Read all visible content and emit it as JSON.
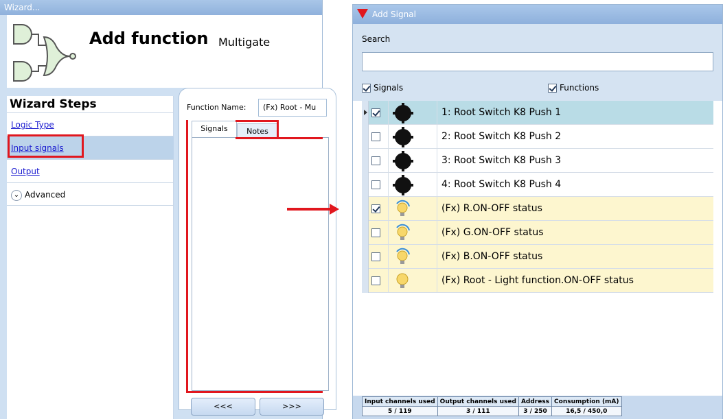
{
  "wizard": {
    "window_title": "Wizard...",
    "header_title": "Add function",
    "header_subtitle": "Multigate",
    "steps_title": "Wizard Steps",
    "steps": [
      {
        "label": "Logic Type"
      },
      {
        "label": "Input signals"
      },
      {
        "label": "Output"
      }
    ],
    "advanced_label": "Advanced",
    "function_name_label": "Function Name:",
    "function_name_value": "(Fx) Root - Mu",
    "tabs": [
      {
        "label": "Signals"
      },
      {
        "label": "Notes"
      }
    ],
    "back_button": "<<<",
    "next_button": ">>>"
  },
  "add_signal": {
    "window_title": "Add Signal",
    "search_label": "Search",
    "search_value": "",
    "filter_signals": {
      "label": "Signals",
      "checked": true
    },
    "filter_functions": {
      "label": "Functions",
      "checked": true
    },
    "rows": [
      {
        "checked": true,
        "icon": "push-button-icon",
        "label": "1: Root Switch K8 Push 1",
        "state": "selected"
      },
      {
        "checked": false,
        "icon": "push-button-icon",
        "label": "2: Root Switch K8 Push 2",
        "state": "normal"
      },
      {
        "checked": false,
        "icon": "push-button-icon",
        "label": "3: Root Switch K8 Push 3",
        "state": "normal"
      },
      {
        "checked": false,
        "icon": "push-button-icon",
        "label": "4: Root Switch K8 Push 4",
        "state": "normal"
      },
      {
        "checked": true,
        "icon": "dimmer-bulb-icon",
        "label": "(Fx) R.ON-OFF status",
        "state": "function"
      },
      {
        "checked": false,
        "icon": "dimmer-bulb-icon",
        "label": "(Fx) G.ON-OFF status",
        "state": "function"
      },
      {
        "checked": false,
        "icon": "dimmer-bulb-icon",
        "label": "(Fx) B.ON-OFF status",
        "state": "function"
      },
      {
        "checked": false,
        "icon": "light-bulb-icon",
        "label": "(Fx) Root - Light function.ON-OFF status",
        "state": "function"
      }
    ],
    "stats": {
      "headers": [
        "Input channels used",
        "Output channels used",
        "Address",
        "Consumption (mA)"
      ],
      "values": [
        "5 / 119",
        "3 / 111",
        "3 / 250",
        "16,5 / 450,0"
      ]
    }
  },
  "colors": {
    "highlight_red": "#e1171e",
    "selected_row": "#b9dce6",
    "function_row": "#fdf6cf",
    "title_bar": "#8eb0dc"
  }
}
